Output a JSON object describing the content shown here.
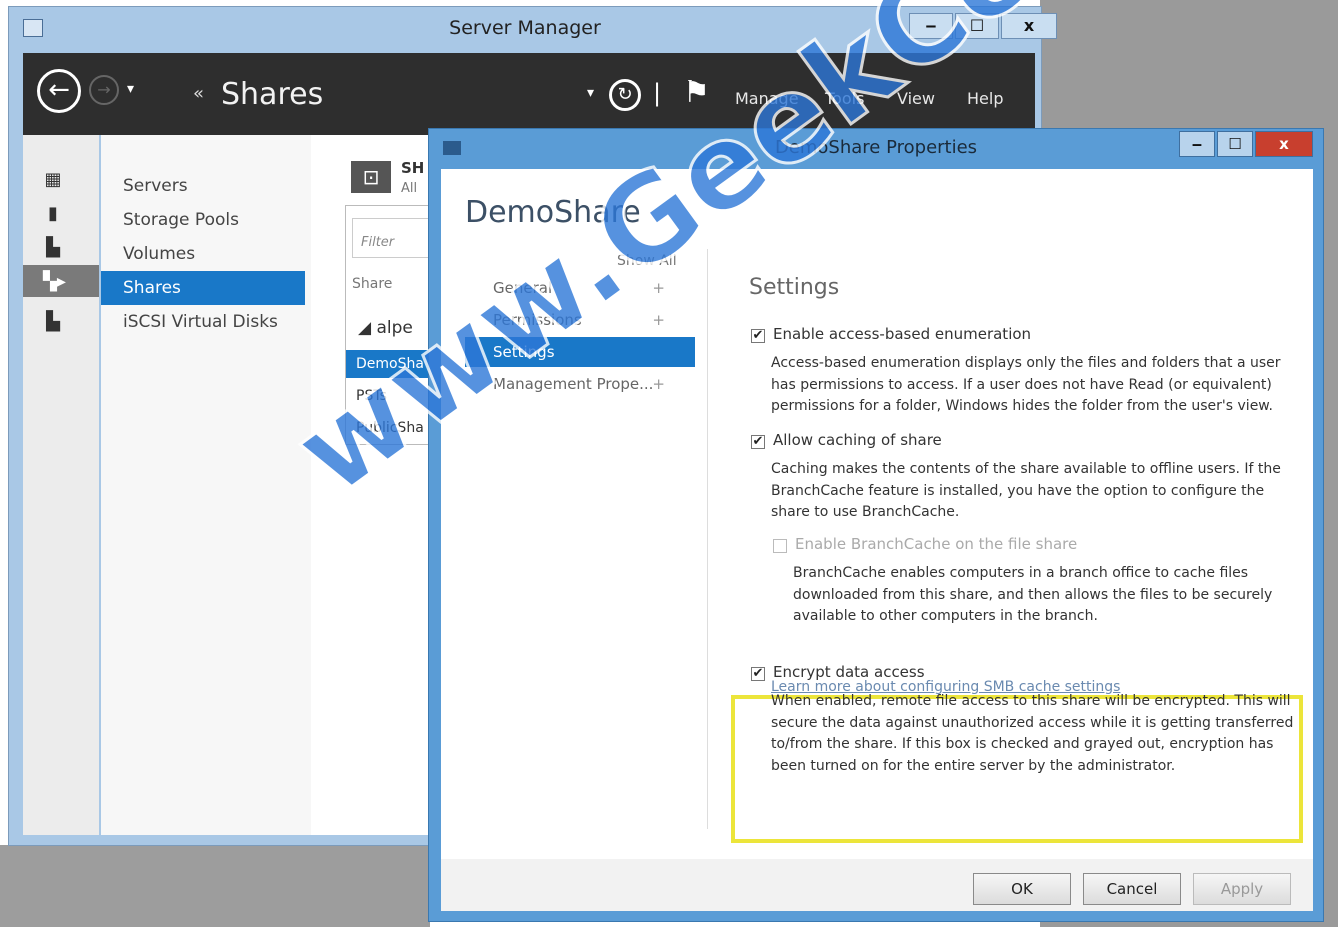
{
  "server_manager": {
    "title": "Server Manager",
    "window_buttons": [
      "‒",
      "☐",
      "x"
    ],
    "breadcrumb": "Shares",
    "menu": [
      "Manage",
      "Tools",
      "View",
      "Help"
    ],
    "nav_items": [
      {
        "label": "Servers",
        "selected": false
      },
      {
        "label": "Storage Pools",
        "selected": false
      },
      {
        "label": "Volumes",
        "selected": false
      },
      {
        "label": "Shares",
        "selected": true
      },
      {
        "label": "iSCSI Virtual Disks",
        "selected": false
      }
    ],
    "shares_tile": {
      "header": "SH",
      "subheader": "All",
      "filter_placeholder": "Filter",
      "column_header": "Share",
      "group": "alpe",
      "rows": [
        "DemoSha",
        "PSTs",
        "PublicSha"
      ]
    }
  },
  "dialog": {
    "title": "DemoShare Properties",
    "heading": "DemoShare",
    "show_all": "Show All",
    "nav": [
      {
        "label": "General",
        "selected": false
      },
      {
        "label": "Permissions",
        "selected": false
      },
      {
        "label": "Settings",
        "selected": true
      },
      {
        "label": "Management Prope...",
        "selected": false
      }
    ],
    "section_title": "Settings",
    "options": {
      "abe_label": "Enable access-based enumeration",
      "abe_checked": true,
      "abe_desc": [
        "Access-based enumeration displays only the files and folders that a user",
        "has permissions to access. If a user does not have Read (or equivalent)",
        "permissions for a folder, Windows hides the folder from the user's view."
      ],
      "caching_label": "Allow caching of share",
      "caching_checked": true,
      "caching_desc": [
        "Caching makes the contents of the share available to offline users. If the",
        "BranchCache feature is installed, you have the option to configure the",
        "share to use BranchCache."
      ],
      "branchcache_label": "Enable BranchCache on the file share",
      "branchcache_checked": false,
      "branchcache_desc": [
        "BranchCache enables computers in a branch office to cache files",
        "downloaded from this share, and then allows the files to be securely",
        "available to other computers in the branch."
      ],
      "learn_more": "Learn more about configuring SMB cache settings",
      "encrypt_label": "Encrypt data access",
      "encrypt_checked": true,
      "encrypt_desc": [
        "When enabled, remote file access to this share will be encrypted. This will",
        "secure the data against unauthorized access while it is getting transferred",
        "to/from the share. If this box is checked and grayed out, encryption has",
        "been turned on for the entire server by the administrator."
      ]
    },
    "buttons": {
      "ok": "OK",
      "cancel": "Cancel",
      "apply": "Apply"
    }
  },
  "watermark": "www.GeekCert.com",
  "colors": {
    "accent": "#1978c8",
    "highlight": "#ece53a",
    "watermark": "#2d77d8"
  }
}
